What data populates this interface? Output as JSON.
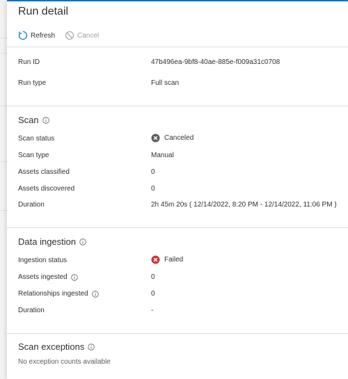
{
  "panel": {
    "title": "Run detail",
    "toolbar": {
      "refresh_label": "Refresh",
      "cancel_label": "Cancel"
    }
  },
  "run": {
    "run_id_label": "Run ID",
    "run_id_value": "47b496ea-9bf8-40ae-885e-f009a31c0708",
    "run_type_label": "Run type",
    "run_type_value": "Full scan"
  },
  "scan": {
    "title": "Scan",
    "status_label": "Scan status",
    "status_value": "Canceled",
    "type_label": "Scan type",
    "type_value": "Manual",
    "classified_label": "Assets classified",
    "classified_value": "0",
    "discovered_label": "Assets discovered",
    "discovered_value": "0",
    "duration_label": "Duration",
    "duration_value": "2h 45m 20s ( 12/14/2022, 8:20 PM - 12/14/2022, 11:06 PM )"
  },
  "ingestion": {
    "title": "Data ingestion",
    "status_label": "Ingestion status",
    "status_value": "Failed",
    "assets_label": "Assets ingested",
    "assets_value": "0",
    "relationships_label": "Relationships ingested",
    "relationships_value": "0",
    "duration_label": "Duration",
    "duration_value": "-"
  },
  "exceptions": {
    "title": "Scan exceptions",
    "message": "No exception counts available"
  },
  "colors": {
    "accent": "#0078d4",
    "failed": "#d13438",
    "canceled": "#605e5c",
    "separator": "#e1dfdd"
  }
}
